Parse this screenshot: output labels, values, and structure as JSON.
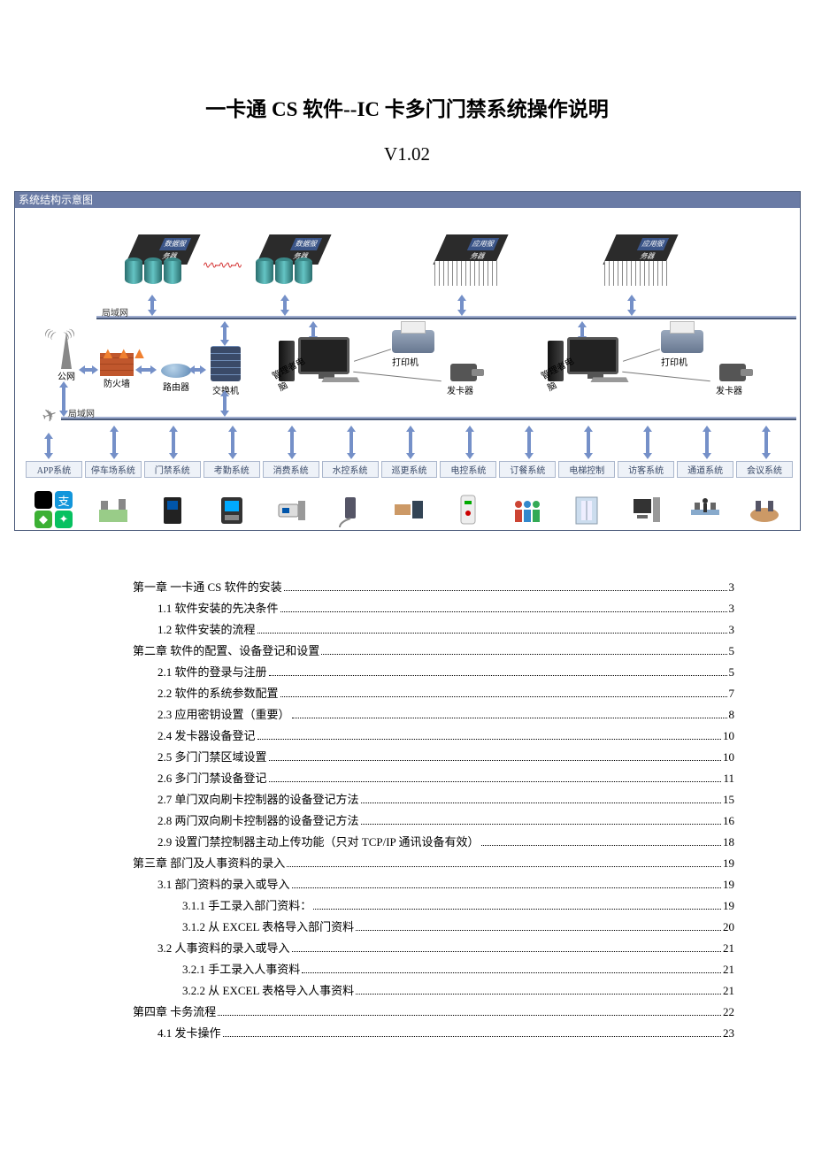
{
  "title": "一卡通 CS 软件--IC 卡多门门禁系统操作说明",
  "version": "V1.02",
  "diagram": {
    "header": "系统结构示意图",
    "bus1_label": "局域网",
    "bus2_label": "局域网",
    "servers": {
      "db1": "数据服务器",
      "db2": "数据服务器",
      "app1": "应用服务器",
      "app2": "应用服务器"
    },
    "devices": {
      "tower": "公网",
      "firewall": "防火墙",
      "router": "路由器",
      "switch": "交换机",
      "admin_pc": "管理者电脑",
      "printer": "打印机",
      "card_issuer": "发卡器"
    },
    "subsystems": [
      "APP系统",
      "停车场系统",
      "门禁系统",
      "考勤系统",
      "消费系统",
      "水控系统",
      "巡更系统",
      "电控系统",
      "订餐系统",
      "电梯控制",
      "访客系统",
      "通道系统",
      "会议系统"
    ]
  },
  "toc": [
    {
      "level": 1,
      "label": "第一章  一卡通 CS 软件的安装",
      "page": "3"
    },
    {
      "level": 2,
      "label": "1.1  软件安装的先决条件",
      "page": "3"
    },
    {
      "level": 2,
      "label": "1.2  软件安装的流程",
      "page": "3"
    },
    {
      "level": 1,
      "label": "第二章  软件的配置、设备登记和设置",
      "page": "5"
    },
    {
      "level": 2,
      "label": "2.1  软件的登录与注册",
      "page": "5"
    },
    {
      "level": 2,
      "label": "2.2  软件的系统参数配置",
      "page": "7"
    },
    {
      "level": 2,
      "label": "2.3  应用密钥设置（重要）",
      "page": "8"
    },
    {
      "level": 2,
      "label": "2.4  发卡器设备登记",
      "page": "10"
    },
    {
      "level": 2,
      "label": "2.5  多门门禁区域设置",
      "page": "10"
    },
    {
      "level": 2,
      "label": "2.6  多门门禁设备登记",
      "page": "11"
    },
    {
      "level": 2,
      "label": "2.7  单门双向刷卡控制器的设备登记方法",
      "page": "15"
    },
    {
      "level": 2,
      "label": "2.8  两门双向刷卡控制器的设备登记方法",
      "page": "16"
    },
    {
      "level": 2,
      "label": "2.9  设置门禁控制器主动上传功能（只对 TCP/IP 通讯设备有效）",
      "page": "18"
    },
    {
      "level": 1,
      "label": "第三章  部门及人事资料的录入",
      "page": "19"
    },
    {
      "level": 2,
      "label": "3.1  部门资料的录入或导入",
      "page": "19"
    },
    {
      "level": 3,
      "label": "3.1.1  手工录入部门资料：",
      "page": "19"
    },
    {
      "level": 3,
      "label": "3.1.2  从 EXCEL 表格导入部门资料",
      "page": "20"
    },
    {
      "level": 2,
      "label": "3.2  人事资料的录入或导入",
      "page": "21"
    },
    {
      "level": 3,
      "label": "3.2.1  手工录入人事资料",
      "page": "21"
    },
    {
      "level": 3,
      "label": "3.2.2  从 EXCEL 表格导入人事资料",
      "page": "21"
    },
    {
      "level": 1,
      "label": "第四章  卡务流程",
      "page": "22"
    },
    {
      "level": 2,
      "label": "4.1  发卡操作",
      "page": "23"
    }
  ]
}
